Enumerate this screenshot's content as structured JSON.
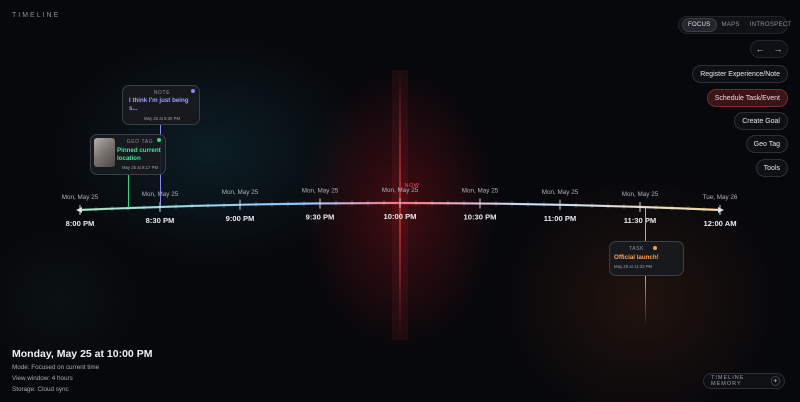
{
  "app": {
    "title": "TIMELINE"
  },
  "mode_tabs": [
    {
      "label": "FOCUS",
      "active": true
    },
    {
      "label": "MAPS",
      "active": false
    },
    {
      "label": "INTROSPECT",
      "active": false
    }
  ],
  "nav": {
    "prev": "←",
    "next": "→"
  },
  "actions": [
    {
      "label": "Register Experience/Note",
      "primary": false
    },
    {
      "label": "Schedule Task/Event",
      "primary": true
    },
    {
      "label": "Create Goal",
      "primary": false
    },
    {
      "label": "Geo Tag",
      "primary": false
    },
    {
      "label": "Tools",
      "primary": false
    }
  ],
  "timeline": {
    "now_label": "NOW",
    "ticks": [
      {
        "date": "Mon, May 25",
        "time": "8:00 PM"
      },
      {
        "date": "Mon, May 25",
        "time": "8:30 PM"
      },
      {
        "date": "Mon, May 25",
        "time": "9:00 PM"
      },
      {
        "date": "Mon, May 25",
        "time": "9:30 PM"
      },
      {
        "date": "Mon, May 25",
        "time": "10:00 PM"
      },
      {
        "date": "Mon, May 25",
        "time": "10:30 PM"
      },
      {
        "date": "Mon, May 25",
        "time": "11:00 PM"
      },
      {
        "date": "Mon, May 25",
        "time": "11:30 PM"
      },
      {
        "date": "Tue, May 26",
        "time": "12:00 AM"
      }
    ],
    "minor_ticks": 5,
    "events": [
      {
        "type": "NOTE",
        "title": "I think I'm just being s...",
        "timestamp": "May 25 at 8:30 PM",
        "color": "#8f86ff"
      },
      {
        "type": "GEO TAG",
        "title": "Pinned current location",
        "timestamp": "May 25 at 8:17 PM",
        "color": "#2fd98a"
      },
      {
        "type": "TASK",
        "title": "Official launch!",
        "timestamp": "May 25 at 11:33 PM",
        "color": "#ff9a3a"
      }
    ],
    "colors": {
      "now": "#ff3b4a",
      "line_start": "#7fd3a0",
      "line_mid": "#7aa8ff",
      "line_end": "#f0c878"
    }
  },
  "status": {
    "datetime": "Monday, May 25 at 10:00 PM",
    "mode": "Mode: Focused on current time",
    "window": "View window: 4 hours",
    "storage": "Storage: Cloud sync"
  },
  "memory": {
    "label": "TIMELINE MEMORY",
    "add": "+"
  }
}
